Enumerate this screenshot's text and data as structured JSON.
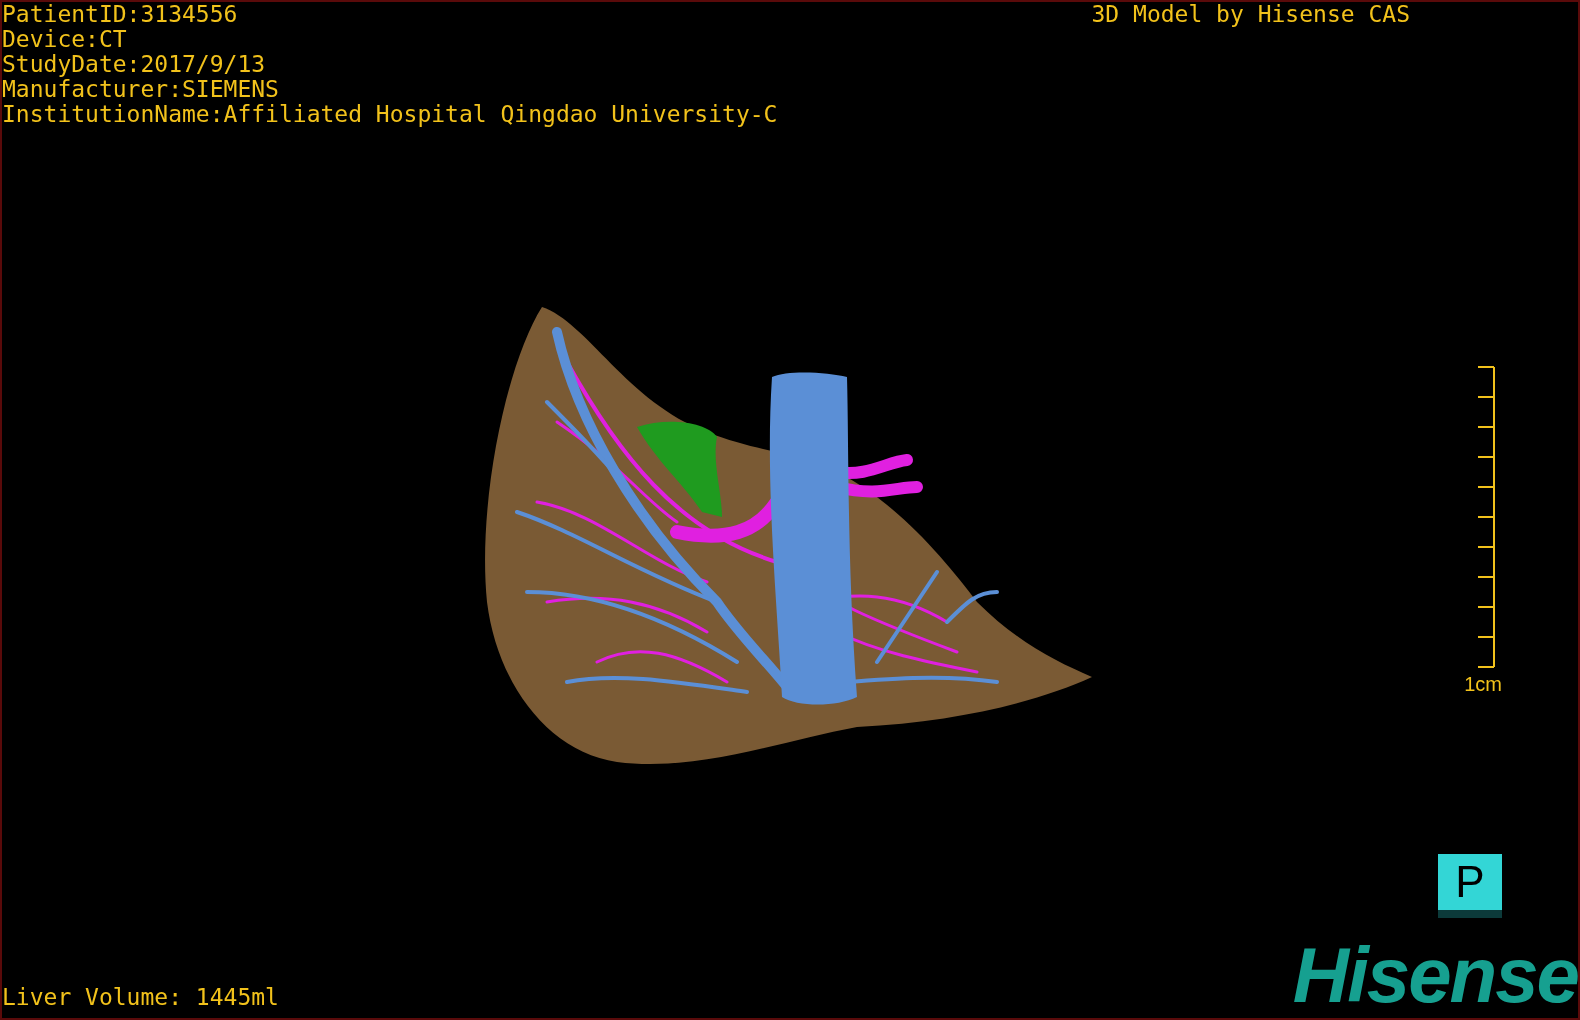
{
  "patient_info": [
    "PatientID:3134556",
    "Device:CT",
    "StudyDate:2017/9/13",
    "Manufacturer:SIEMENS",
    "InstitutionName:Affiliated Hospital Qingdao University-C"
  ],
  "title": "3D Model by Hisense CAS",
  "scale_bar": {
    "label": "1cm"
  },
  "volume": "Liver Volume: 1445ml",
  "view_button": {
    "label": "P"
  },
  "logo": "Hisense"
}
